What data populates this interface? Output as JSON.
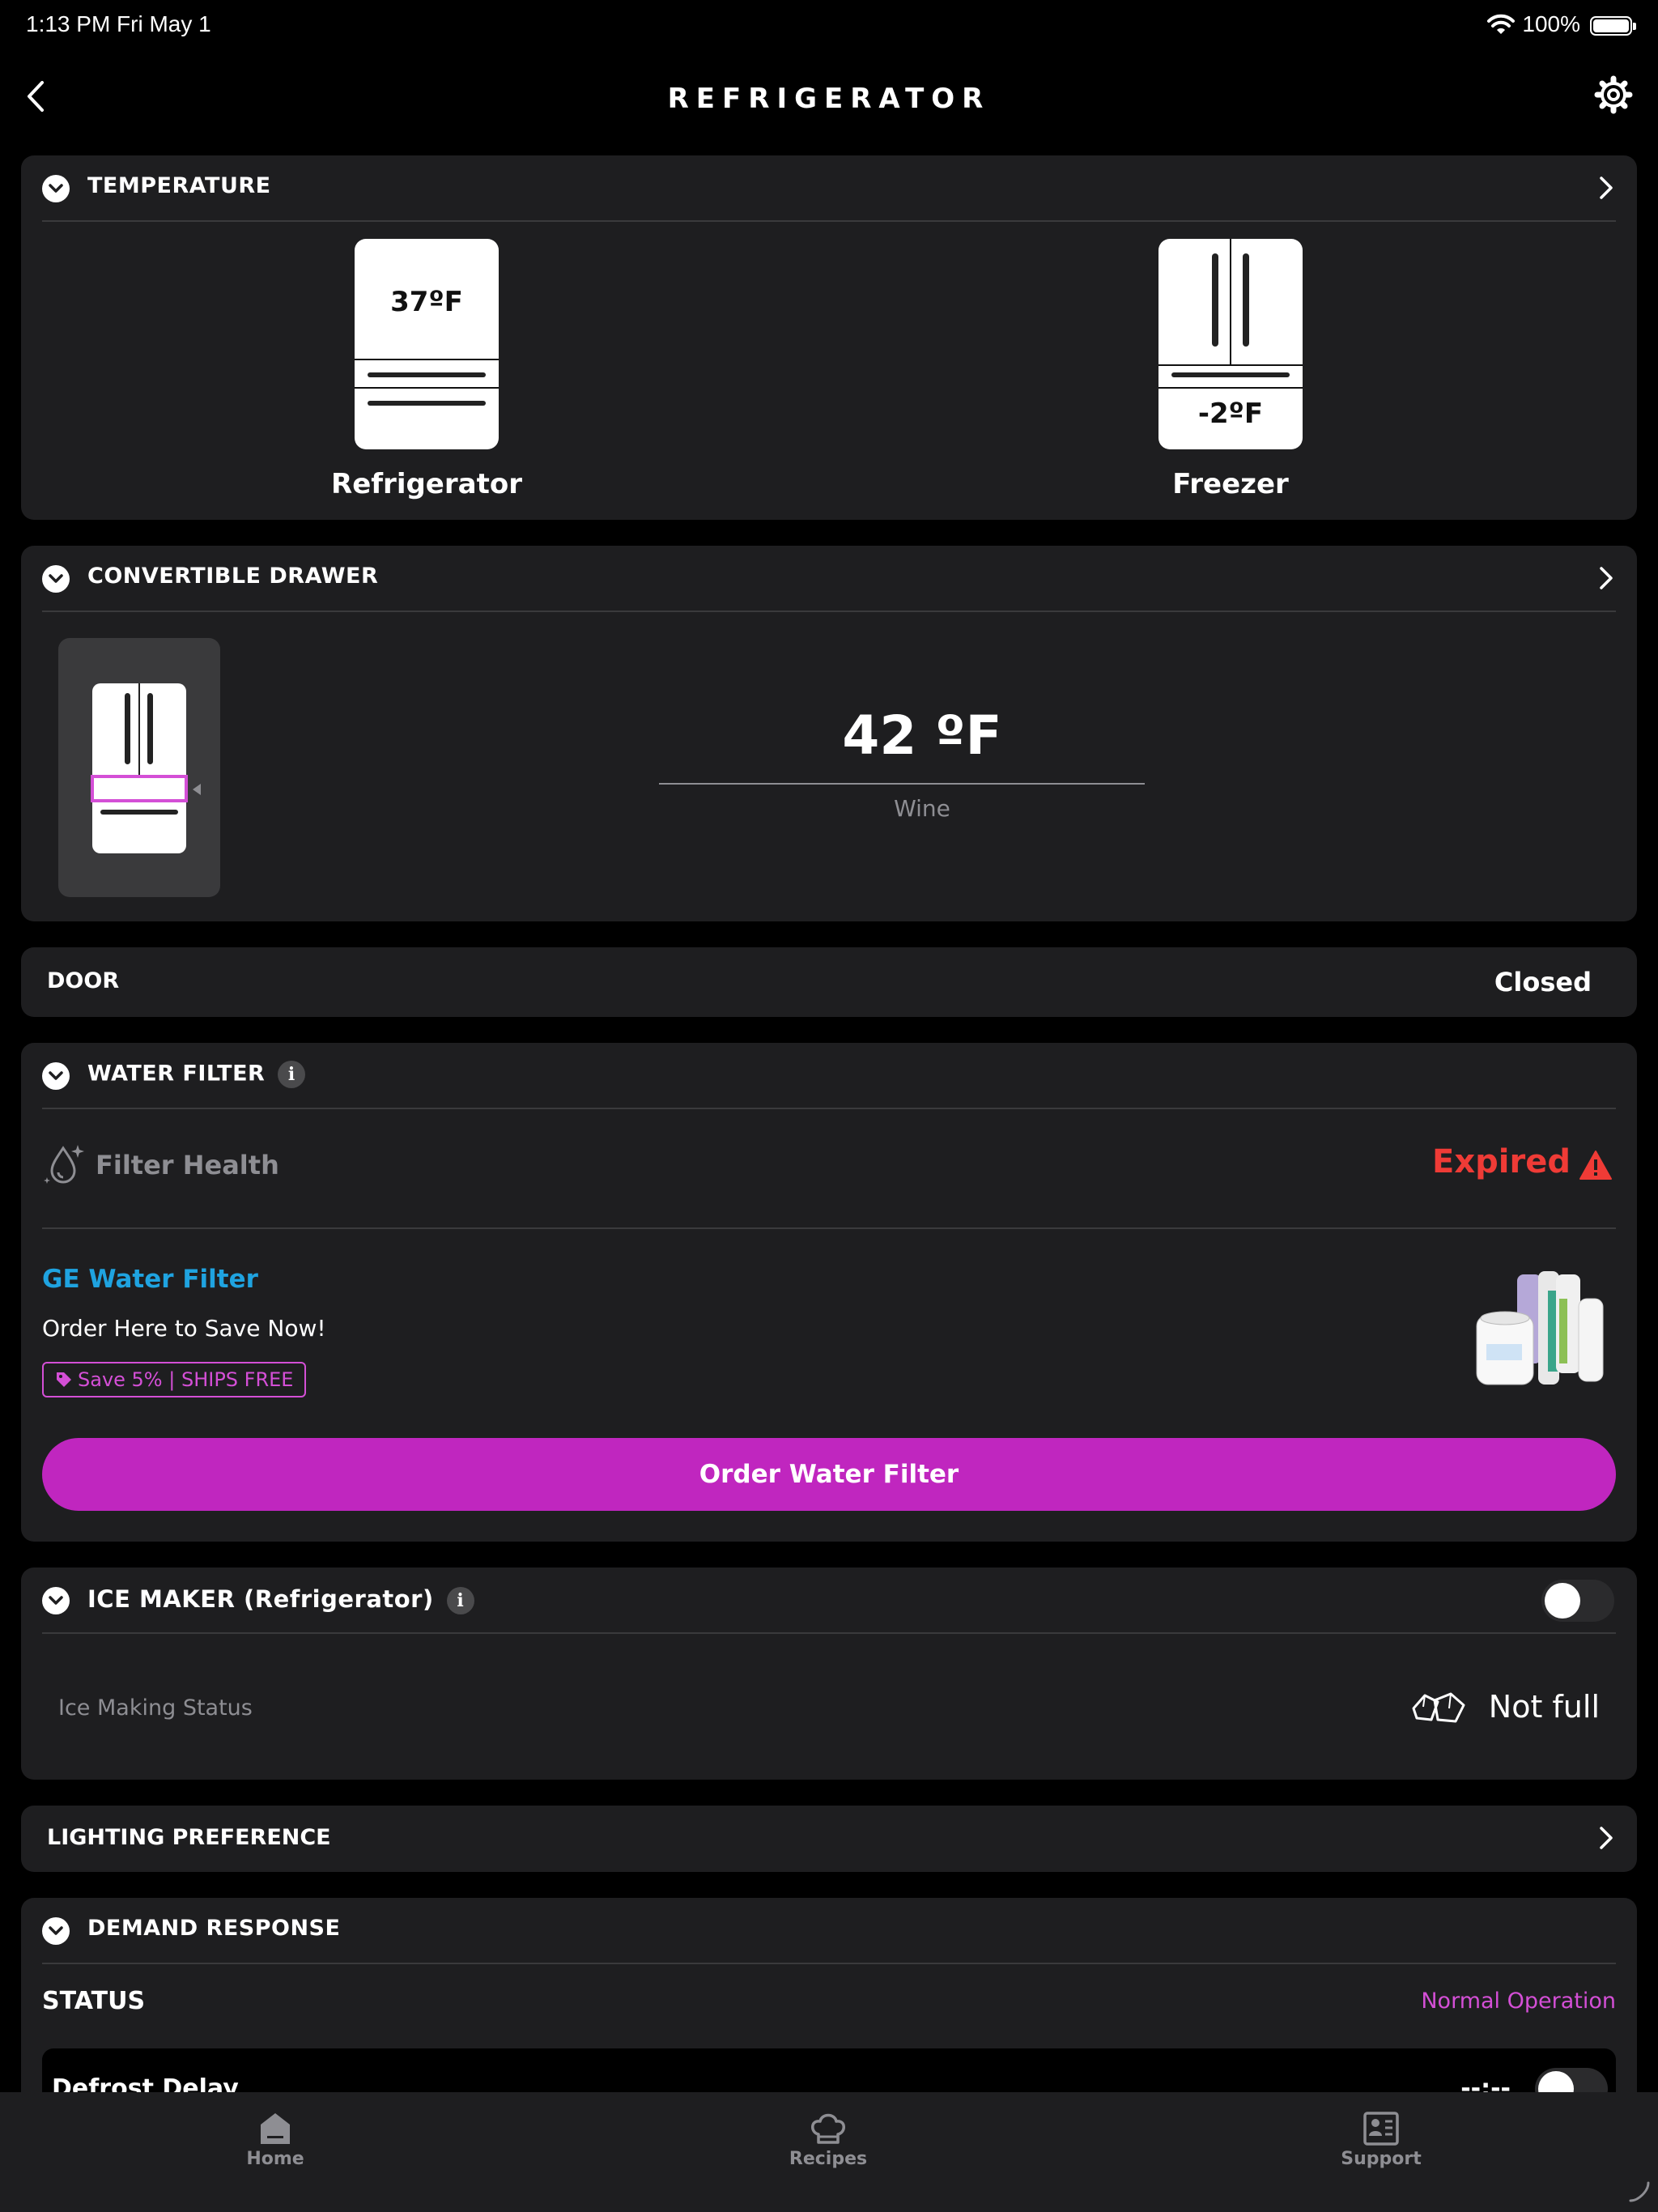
{
  "status_bar": {
    "time": "1:13 PM   Fri May 1",
    "battery": "100%"
  },
  "header": {
    "title": "REFRIGERATOR"
  },
  "temperature": {
    "title": "TEMPERATURE",
    "fridge_temp": "37ºF",
    "fridge_label": "Refrigerator",
    "freezer_temp": "-2ºF",
    "freezer_label": "Freezer"
  },
  "drawer": {
    "title": "CONVERTIBLE DRAWER",
    "temp": "42 ºF",
    "mode": "Wine"
  },
  "door": {
    "label": "DOOR",
    "value": "Closed"
  },
  "water_filter": {
    "title": "WATER FILTER",
    "health_label": "Filter Health",
    "health_value": "Expired",
    "promo_title": "GE Water Filter",
    "promo_text": "Order Here to Save Now!",
    "promo_badge": "Save 5% | SHIPS FREE",
    "order_button": "Order Water Filter"
  },
  "ice_maker": {
    "title": "ICE MAKER (Refrigerator)",
    "status_label": "Ice Making Status",
    "status_value": "Not full",
    "enabled": false
  },
  "lighting": {
    "title": "LIGHTING PREFERENCE"
  },
  "demand_response": {
    "title": "DEMAND RESPONSE",
    "status_label": "STATUS",
    "status_value": "Normal Operation",
    "defrost_label": "Defrost Delay",
    "defrost_value": "--:--"
  },
  "tabs": [
    {
      "label": "Home"
    },
    {
      "label": "Recipes"
    },
    {
      "label": "Support"
    }
  ],
  "colors": {
    "accent": "#c026bf",
    "link": "#1fa3e0",
    "error": "#ef3b36",
    "badge": "#d44fd6"
  }
}
